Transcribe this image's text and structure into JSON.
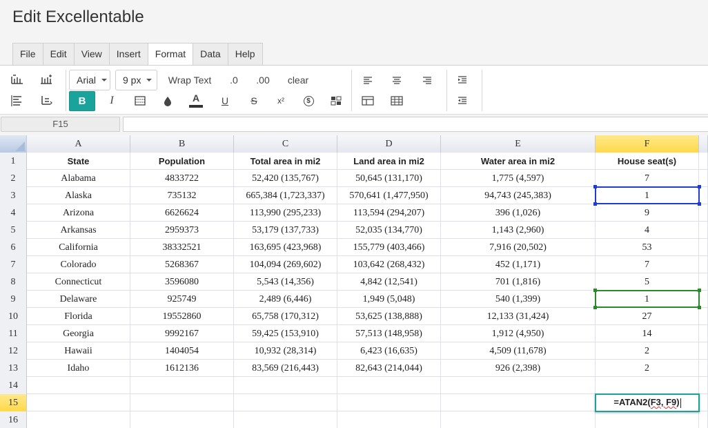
{
  "app": {
    "title": "Edit Excellentable"
  },
  "menu": {
    "tabs": [
      {
        "label": "File"
      },
      {
        "label": "Edit"
      },
      {
        "label": "View"
      },
      {
        "label": "Insert"
      },
      {
        "label": "Format"
      },
      {
        "label": "Data"
      },
      {
        "label": "Help"
      }
    ],
    "active": "Format"
  },
  "toolbar": {
    "font_family": "Arial",
    "font_size": "9 px",
    "wrap_text": "Wrap Text",
    "decimal_decrease": ".0",
    "decimal_increase": ".00",
    "clear": "clear",
    "bold": "B",
    "italic": "I",
    "text_color_glyph": "A",
    "underline": "U",
    "strike": "S",
    "superscript": "x²",
    "currency": "$"
  },
  "formula_bar": {
    "cell_ref": "F15",
    "value": ""
  },
  "grid": {
    "columns": [
      "A",
      "B",
      "C",
      "D",
      "E",
      "F"
    ],
    "selected_column": "F",
    "rows": [
      {
        "num": "1",
        "cells": [
          "State",
          "Population",
          "Total area in mi2",
          "Land area in mi2",
          "Water area in mi2",
          "House seat(s)"
        ]
      },
      {
        "num": "2",
        "cells": [
          "Alabama",
          "4833722",
          "52,420 (135,767)",
          "50,645 (131,170)",
          "1,775 (4,597)",
          "7"
        ]
      },
      {
        "num": "3",
        "cells": [
          "Alaska",
          "735132",
          "665,384 (1,723,337)",
          "570,641 (1,477,950)",
          "94,743 (245,383)",
          "1"
        ]
      },
      {
        "num": "4",
        "cells": [
          "Arizona",
          "6626624",
          "113,990 (295,233)",
          "113,594 (294,207)",
          "396 (1,026)",
          "9"
        ]
      },
      {
        "num": "5",
        "cells": [
          "Arkansas",
          "2959373",
          "53,179 (137,733)",
          "52,035 (134,770)",
          "1,143 (2,960)",
          "4"
        ]
      },
      {
        "num": "6",
        "cells": [
          "California",
          "38332521",
          "163,695 (423,968)",
          "155,779 (403,466)",
          "7,916 (20,502)",
          "53"
        ]
      },
      {
        "num": "7",
        "cells": [
          "Colorado",
          "5268367",
          "104,094 (269,602)",
          "103,642 (268,432)",
          "452 (1,171)",
          "7"
        ]
      },
      {
        "num": "8",
        "cells": [
          "Connecticut",
          "3596080",
          "5,543 (14,356)",
          "4,842 (12,541)",
          "701 (1,816)",
          "5"
        ]
      },
      {
        "num": "9",
        "cells": [
          "Delaware",
          "925749",
          "2,489 (6,446)",
          "1,949 (5,048)",
          "540 (1,399)",
          "1"
        ]
      },
      {
        "num": "10",
        "cells": [
          "Florida",
          "19552860",
          "65,758 (170,312)",
          "53,625 (138,888)",
          "12,133 (31,424)",
          "27"
        ]
      },
      {
        "num": "11",
        "cells": [
          "Georgia",
          "9992167",
          "59,425 (153,910)",
          "57,513 (148,958)",
          "1,912 (4,950)",
          "14"
        ]
      },
      {
        "num": "12",
        "cells": [
          "Hawaii",
          "1404054",
          "10,932 (28,314)",
          "6,423 (16,635)",
          "4,509 (11,678)",
          "2"
        ]
      },
      {
        "num": "13",
        "cells": [
          "Idaho",
          "1612136",
          "83,569 (216,443)",
          "82,643 (214,044)",
          "926 (2,398)",
          "2"
        ]
      },
      {
        "num": "14",
        "cells": [
          "",
          "",
          "",
          "",
          "",
          ""
        ]
      },
      {
        "num": "15",
        "cells": [
          "",
          "",
          "",
          "",
          "",
          ""
        ]
      },
      {
        "num": "16",
        "cells": [
          "",
          "",
          "",
          "",
          "",
          ""
        ]
      }
    ],
    "selected_row": "15",
    "editing_cell": {
      "ref": "F15",
      "func": "=ATAN2(",
      "args": "F3, F9",
      "close": ")"
    }
  },
  "colors": {
    "accent": "#1aa39b",
    "selection_blue": "#1f3bd6",
    "selection_green": "#2a8a2a",
    "header_selected": "#ffd84a"
  },
  "icons": [
    "insert-rows-above-icon",
    "insert-columns-icon",
    "delete-rows-icon",
    "delete-columns-icon",
    "borders-icon",
    "fill-color-icon",
    "text-color-icon",
    "currency-icon",
    "conditional-format-icon",
    "align-left-icon",
    "align-center-icon",
    "align-right-icon",
    "indent-icon",
    "outdent-icon",
    "table-icon",
    "grid-icon"
  ]
}
